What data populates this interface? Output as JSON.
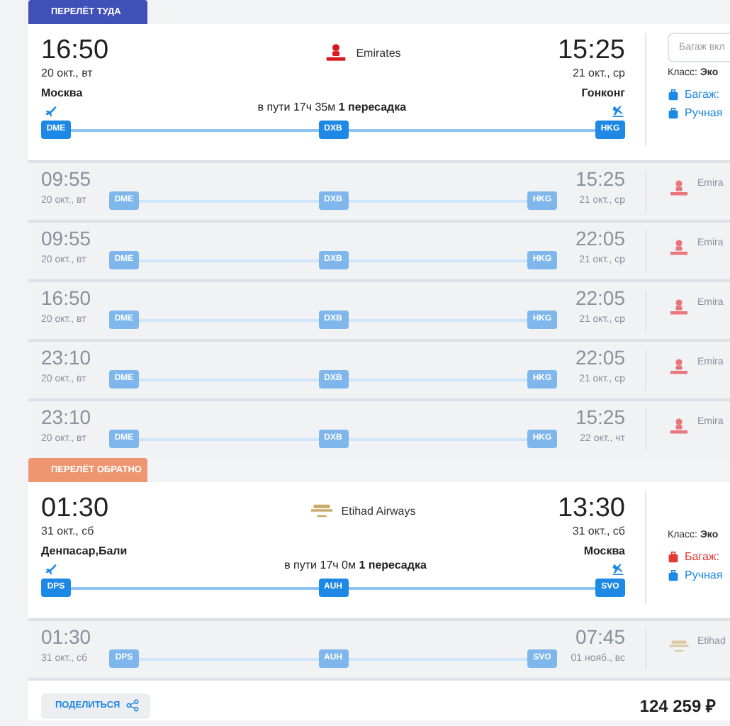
{
  "sections": [
    {
      "kind": "outbound",
      "label": "ПЕРЕЛЁТ ТУДА",
      "flight": {
        "departure": {
          "time": "16:50",
          "date": "20 окт., вт",
          "city": "Москва"
        },
        "airline": {
          "kind": "emirates",
          "name": "Emirates"
        },
        "duration": "в пути 17ч 35м **1 пересадка**",
        "arrival": {
          "time": "15:25",
          "date": "21 окт., ср",
          "city": "Гонконг"
        },
        "airports": [
          "DME",
          "DXB",
          "HKG"
        ]
      },
      "options": {
        "baggage_field": {
          "placeholder": "Багаж вкл"
        },
        "class": "Класс: **Эко**",
        "items": [
          {
            "label": "Багаж:",
            "included": true
          },
          {
            "label": "Ручная",
            "included": true
          }
        ]
      },
      "alternatives": [
        {
          "departure_time": "09:55",
          "departure_date": "20 окт., вт",
          "airports": [
            "DME",
            "DXB",
            "HKG"
          ],
          "arrival_time": "15:25",
          "arrival_date": "21 окт., ср",
          "airline": {
            "kind": "emirates",
            "name": "Emira"
          }
        },
        {
          "departure_time": "09:55",
          "departure_date": "20 окт., вт",
          "airports": [
            "DME",
            "DXB",
            "HKG"
          ],
          "arrival_time": "22:05",
          "arrival_date": "21 окт., ср",
          "airline": {
            "kind": "emirates",
            "name": "Emira"
          }
        },
        {
          "departure_time": "16:50",
          "departure_date": "20 окт., вт",
          "airports": [
            "DME",
            "DXB",
            "HKG"
          ],
          "arrival_time": "22:05",
          "arrival_date": "21 окт., ср",
          "airline": {
            "kind": "emirates",
            "name": "Emira"
          }
        },
        {
          "departure_time": "23:10",
          "departure_date": "20 окт., вт",
          "airports": [
            "DME",
            "DXB",
            "HKG"
          ],
          "arrival_time": "22:05",
          "arrival_date": "21 окт., ср",
          "airline": {
            "kind": "emirates",
            "name": "Emira"
          }
        },
        {
          "departure_time": "23:10",
          "departure_date": "20 окт., вт",
          "airports": [
            "DME",
            "DXB",
            "HKG"
          ],
          "arrival_time": "15:25",
          "arrival_date": "22 окт., чт",
          "airline": {
            "kind": "emirates",
            "name": "Emira"
          }
        }
      ]
    },
    {
      "kind": "return",
      "label": "ПЕРЕЛЁТ ОБРАТНО",
      "flight": {
        "departure": {
          "time": "01:30",
          "date": "31 окт., сб",
          "city": "Денпасар,Бали"
        },
        "airline": {
          "kind": "etihad",
          "name": "Etihad Airways"
        },
        "duration": "в пути 17ч 0м **1 пересадка**",
        "arrival": {
          "time": "13:30",
          "date": "31 окт., сб",
          "city": "Москва"
        },
        "airports": [
          "DPS",
          "AUH",
          "SVO"
        ]
      },
      "options": {
        "class": "Класс: **Эко**",
        "items": [
          {
            "label": "Багаж:",
            "included": false
          },
          {
            "label": "Ручная",
            "included": true
          }
        ]
      },
      "alternatives": [
        {
          "departure_time": "01:30",
          "departure_date": "31 окт., сб",
          "airports": [
            "DPS",
            "AUH",
            "SVO"
          ],
          "arrival_time": "07:45",
          "arrival_date": "01 нояб., вс",
          "airline": {
            "kind": "etihad",
            "name": "Etihad"
          }
        }
      ]
    }
  ],
  "footer": {
    "share_button": "ПОДЕЛИТЬСЯ",
    "price": "124 259 ₽"
  }
}
